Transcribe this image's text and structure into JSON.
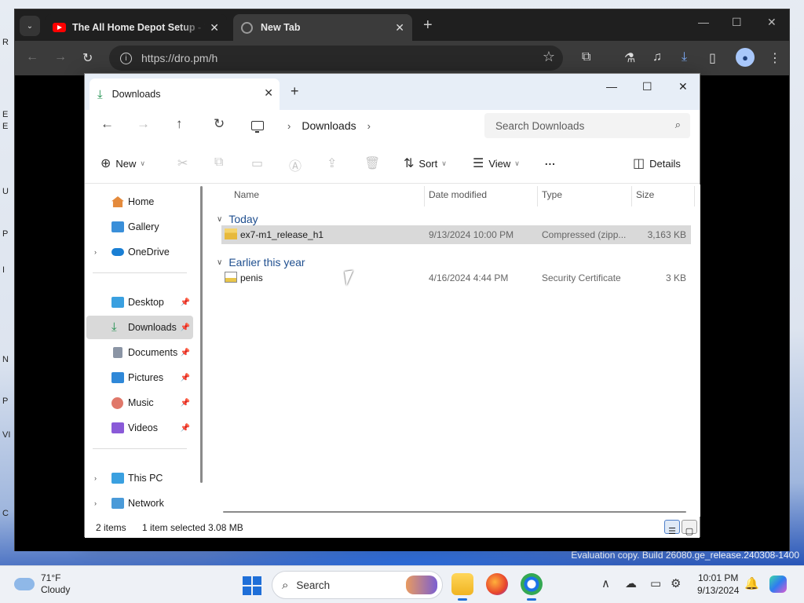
{
  "chrome": {
    "tabs": [
      {
        "title": "The All Home Depot Setup - Yo",
        "icon": "youtube-icon"
      },
      {
        "title": "New Tab",
        "icon": "globe-icon"
      }
    ],
    "url": "https://dro.pm/h"
  },
  "explorer": {
    "tab_title": "Downloads",
    "breadcrumb": "Downloads",
    "search_placeholder": "Search Downloads",
    "commands": {
      "new": "New",
      "sort": "Sort",
      "view": "View",
      "more": "...",
      "details": "Details"
    },
    "nav": {
      "home": "Home",
      "gallery": "Gallery",
      "onedrive": "OneDrive",
      "desktop": "Desktop",
      "downloads": "Downloads",
      "documents": "Documents",
      "pictures": "Pictures",
      "music": "Music",
      "videos": "Videos",
      "thispc": "This PC",
      "network": "Network"
    },
    "columns": {
      "name": "Name",
      "date": "Date modified",
      "type": "Type",
      "size": "Size"
    },
    "groups": [
      {
        "label": "Today",
        "files": [
          {
            "name": "ex7-m1_release_h1",
            "date": "9/13/2024 10:00 PM",
            "type": "Compressed (zipp...",
            "size": "3,163 KB",
            "selected": true
          }
        ]
      },
      {
        "label": "Earlier this year",
        "files": [
          {
            "name": "penis",
            "date": "4/16/2024 4:44 PM",
            "type": "Security Certificate",
            "size": "3 KB",
            "selected": false
          }
        ]
      }
    ],
    "status": {
      "count": "2 items",
      "selection": "1 item selected  3.08 MB"
    }
  },
  "desktop": {
    "watermark": "Evaluation copy. Build 26080.ge_release.240308-1400"
  },
  "taskbar": {
    "weather_temp": "71°F",
    "weather_desc": "Cloudy",
    "search_label": "Search",
    "time": "10:01 PM",
    "date": "9/13/2024"
  }
}
